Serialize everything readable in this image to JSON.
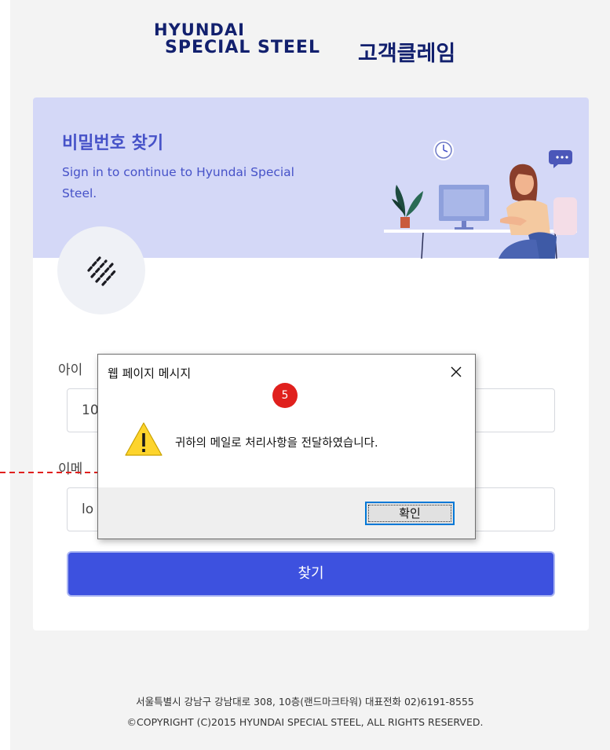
{
  "brand": {
    "logo_line1": "HYUNDAI",
    "logo_line2": "SPECIAL STEEL",
    "service_title": "고객클레임"
  },
  "hero": {
    "title": "비밀번호 찾기",
    "subtitle": "Sign in to continue to Hyundai Special Steel."
  },
  "form": {
    "id_label": "아이",
    "id_value": "10",
    "email_label": "이메",
    "email_value": "lo",
    "submit_label": "찾기"
  },
  "footer": {
    "address": "서울특별시 강남구 강남대로 308, 10층(랜드마크타워) 대표전화 02)6191-8555",
    "copyright": "©COPYRIGHT (C)2015 HYUNDAI SPECIAL STEEL, ALL RIGHTS RESERVED."
  },
  "dialog": {
    "title": "웹 페이지 메시지",
    "close_icon": "close-icon",
    "message": "귀하의 메일로 처리사항을 전달하였습니다.",
    "ok_label": "확인",
    "warning_icon": "warning-icon"
  },
  "annotation": {
    "step_number": "5",
    "badge_color": "#e0201d"
  },
  "colors": {
    "brand_navy": "#12206e",
    "accent_blue": "#3d51df",
    "hero_bg": "#d4d8f7"
  }
}
